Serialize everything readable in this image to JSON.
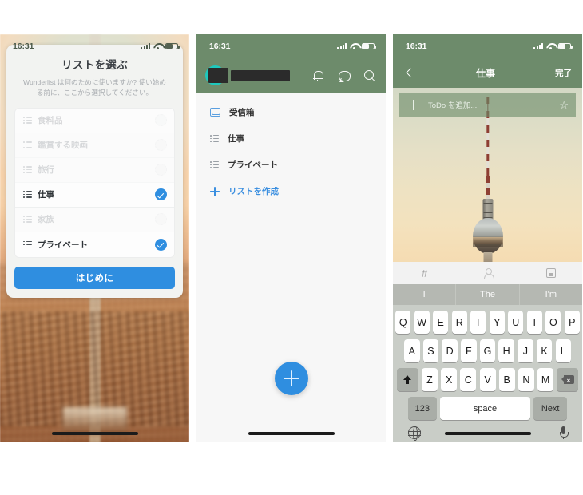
{
  "colors": {
    "accent_blue": "#2f8ee0",
    "header_green": "#6d8b6b",
    "avatar_teal": "#1ec8bd",
    "link_blue": "#3b8fe0"
  },
  "panel1": {
    "name": "onboarding-list-picker",
    "status": {
      "time": "16:31",
      "signal": "signal-bars-icon",
      "wifi": "wifi-icon",
      "battery": "battery-icon"
    },
    "dialog": {
      "title": "リストを選ぶ",
      "subtitle": "Wunderlist は何のために使いますか? 使い始める前に、ここから選択してください。",
      "items": [
        {
          "label": "食料品",
          "selected": false
        },
        {
          "label": "鑑賞する映画",
          "selected": false
        },
        {
          "label": "旅行",
          "selected": false
        },
        {
          "label": "仕事",
          "selected": true
        },
        {
          "label": "家族",
          "selected": false
        },
        {
          "label": "プライベート",
          "selected": true
        }
      ],
      "cta_label": "はじめに"
    }
  },
  "panel2": {
    "name": "lists-home",
    "status": {
      "time": "16:31"
    },
    "header": {
      "avatar": "avatar-redacted",
      "username": "redacted",
      "icons": [
        "bell-icon",
        "chat-icon",
        "search-icon"
      ]
    },
    "nav": [
      {
        "label": "受信箱",
        "icon": "inbox-icon",
        "style": "inbox"
      },
      {
        "label": "仕事",
        "icon": "list-icon",
        "style": "list"
      },
      {
        "label": "プライベート",
        "icon": "list-icon",
        "style": "list"
      },
      {
        "label": "リストを作成",
        "icon": "plus-icon",
        "style": "create"
      }
    ],
    "fab": "add-task-fab"
  },
  "panel3": {
    "name": "list-detail-with-keyboard",
    "status": {
      "time": "16:31"
    },
    "nav": {
      "back": "back-chevron-icon",
      "title": "仕事",
      "done_label": "完了"
    },
    "input": {
      "placeholder": "ToDo を追加...",
      "plus": "plus-icon",
      "star": "☆"
    },
    "photo": "berlin-tv-tower-photo",
    "keyboard": {
      "toolbar": [
        "#",
        "person-icon",
        "calendar-icon"
      ],
      "predictions": [
        "I",
        "The",
        "I'm"
      ],
      "row1": [
        "Q",
        "W",
        "E",
        "R",
        "T",
        "Y",
        "U",
        "I",
        "O",
        "P"
      ],
      "row2": [
        "A",
        "S",
        "D",
        "F",
        "G",
        "H",
        "J",
        "K",
        "L"
      ],
      "row3": [
        "Z",
        "X",
        "C",
        "V",
        "B",
        "N",
        "M"
      ],
      "shift": "shift-icon",
      "delete": "delete-icon",
      "num_label": "123",
      "space_label": "space",
      "next_label": "Next",
      "globe": "globe-icon",
      "mic": "mic-icon"
    }
  }
}
